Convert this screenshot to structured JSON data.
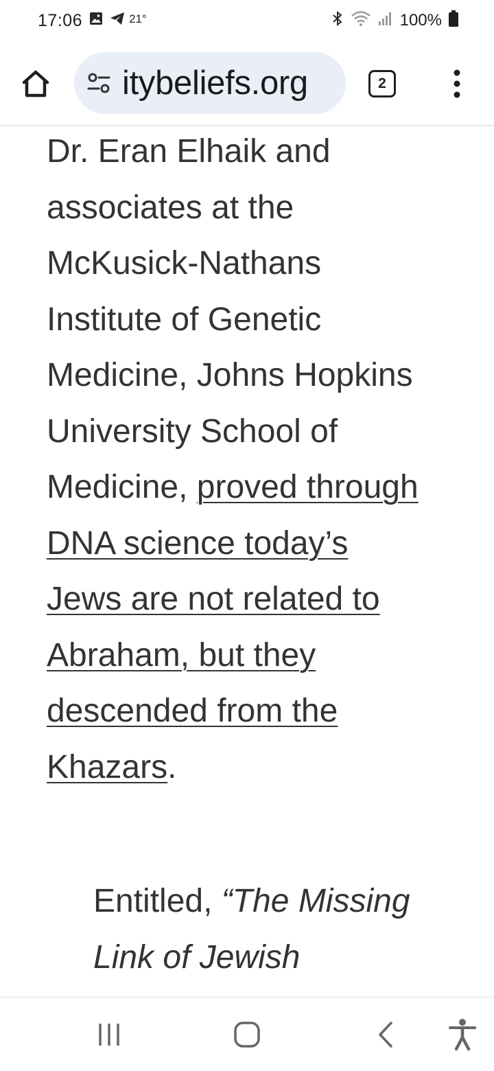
{
  "status_bar": {
    "time": "17:06",
    "temperature": "21°",
    "battery_percent": "100%",
    "icons": [
      "gallery-icon",
      "telegram-icon",
      "bluetooth-icon",
      "wifi-icon",
      "signal-icon",
      "battery-icon"
    ]
  },
  "browser": {
    "url_display": "itybeliefs.org",
    "tab_count": "2"
  },
  "article": {
    "para_text_before_link": "Dr. Eran Elhaik and associates at the McKusick-Nathans Institute of Genetic Medicine, Johns Hopkins University School of Medicine, ",
    "para_link_text": "proved through DNA science today’s Jews are not related to Abraham, but they descended from the Khazars",
    "para_text_after_link": ".",
    "quote_prefix": "Entitled, ",
    "quote_italic": "“The Missing Link of Jewish"
  },
  "colors": {
    "url_pill_bg": "#e9eef7",
    "body_text": "#333333"
  }
}
